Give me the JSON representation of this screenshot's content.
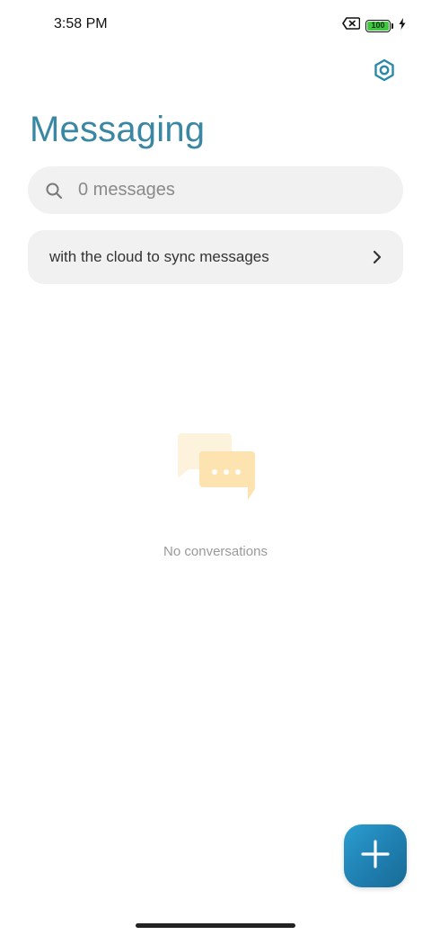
{
  "status_bar": {
    "time": "3:58 PM",
    "battery_level": "100",
    "icons": [
      "sim-blocked-icon",
      "battery-icon",
      "charging-bolt-icon"
    ]
  },
  "header": {
    "title": "Messaging",
    "settings_icon": "settings-hexagon-icon"
  },
  "search": {
    "placeholder": "0 messages",
    "value": "",
    "icon": "search-icon"
  },
  "cloud_banner": {
    "text": "with the cloud to sync messages",
    "icon": "chevron-right-icon"
  },
  "empty_state": {
    "icon": "chat-bubbles-icon",
    "text": "No conversations"
  },
  "fab": {
    "icon": "plus-icon"
  },
  "colors": {
    "title": "#3a87a4",
    "accent": "#1f7fb0",
    "surface": "#f1f1f1",
    "battery_fill": "#3fc83f"
  }
}
